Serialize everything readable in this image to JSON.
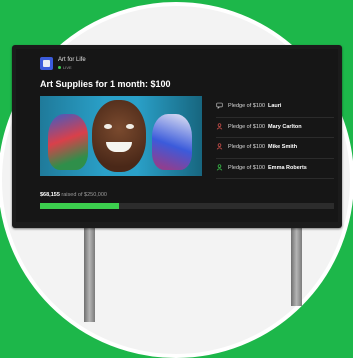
{
  "campaign": {
    "brand": "Art for Life",
    "live_label": "LIVE",
    "title": "Art Supplies for 1 month: $100"
  },
  "pledges": [
    {
      "icon": "chat-icon",
      "text": "Pledge of $100",
      "name": "Lauri"
    },
    {
      "icon": "person-icon",
      "text": "Pledge of $100",
      "name": "Mary Carlton"
    },
    {
      "icon": "person-icon",
      "text": "Pledge of $100",
      "name": "Mike Smith"
    },
    {
      "icon": "person-icon",
      "text": "Pledge of $100",
      "name": "Emma Roberts"
    }
  ],
  "progress": {
    "raised": "$68,155",
    "goal_text": "raised of $250,000",
    "fraction": 0.27
  },
  "colors": {
    "background": "#1db74a",
    "accent": "#3ccf4e",
    "screen": "#161616"
  }
}
